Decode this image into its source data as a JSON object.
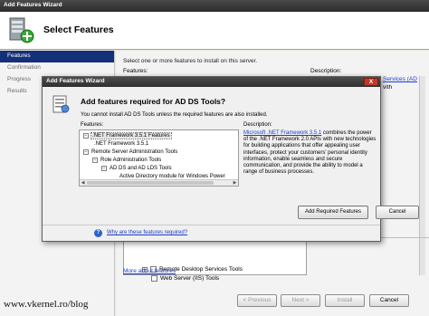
{
  "outer": {
    "window_title": "Add Features Wizard",
    "header_title": "Select Features",
    "nav": [
      "Features",
      "Confirmation",
      "Progress",
      "Results"
    ],
    "instruction": "Select one or more features to install on this server.",
    "features_label": "Features:",
    "description_label": "Description:",
    "description_partial_link": "Services (AD",
    "description_partial_text": "vith",
    "visible_features": [
      {
        "label": "Remote Desktop Services Tools"
      },
      {
        "label": "Web Server (IIS) Tools"
      }
    ],
    "more_about_link": "More about features",
    "buttons": {
      "previous": "< Previous",
      "next": "Next >",
      "install": "Install",
      "cancel": "Cancel"
    }
  },
  "modal": {
    "title": "Add Features Wizard",
    "close": "X",
    "heading": "Add features required for AD DS Tools?",
    "text": "You cannot install AD DS Tools unless the required features are also installed.",
    "features_label": "Features:",
    "description_label": "Description:",
    "tree": [
      {
        "label": ".NET Framework 3.5.1 Features",
        "level": 0,
        "expander": "−",
        "selected": true
      },
      {
        "label": ".NET Framework 3.5.1",
        "level": 1,
        "expander": "",
        "selected": false
      },
      {
        "label": "Remote Server Administration Tools",
        "level": 0,
        "expander": "−",
        "selected": false
      },
      {
        "label": "Role Administration Tools",
        "level": 1,
        "expander": "−",
        "selected": false
      },
      {
        "label": "AD DS and AD LDS Tools",
        "level": 2,
        "expander": "−",
        "selected": false
      },
      {
        "label": "Active Directory module for Windows Power",
        "level": 3,
        "expander": "",
        "selected": false
      }
    ],
    "description_link": "Microsoft .NET Framework 3.5.1",
    "description_text": " combines the power of the .NET Framework 2.0 APIs with new technologies for building applications that offer appealing user interfaces, protect your customers' personal identity information, enable seamless and secure communication, and provide the ability to model a range of business processes.",
    "add_required_button": "Add Required Features",
    "cancel_button": "Cancel",
    "help_link": "Why are these features required?"
  },
  "watermark": "www.vkernel.ro/blog",
  "colors": {
    "nav_active": "#15307a",
    "link": "#1a3dc9",
    "close_button": "#c0392b"
  }
}
